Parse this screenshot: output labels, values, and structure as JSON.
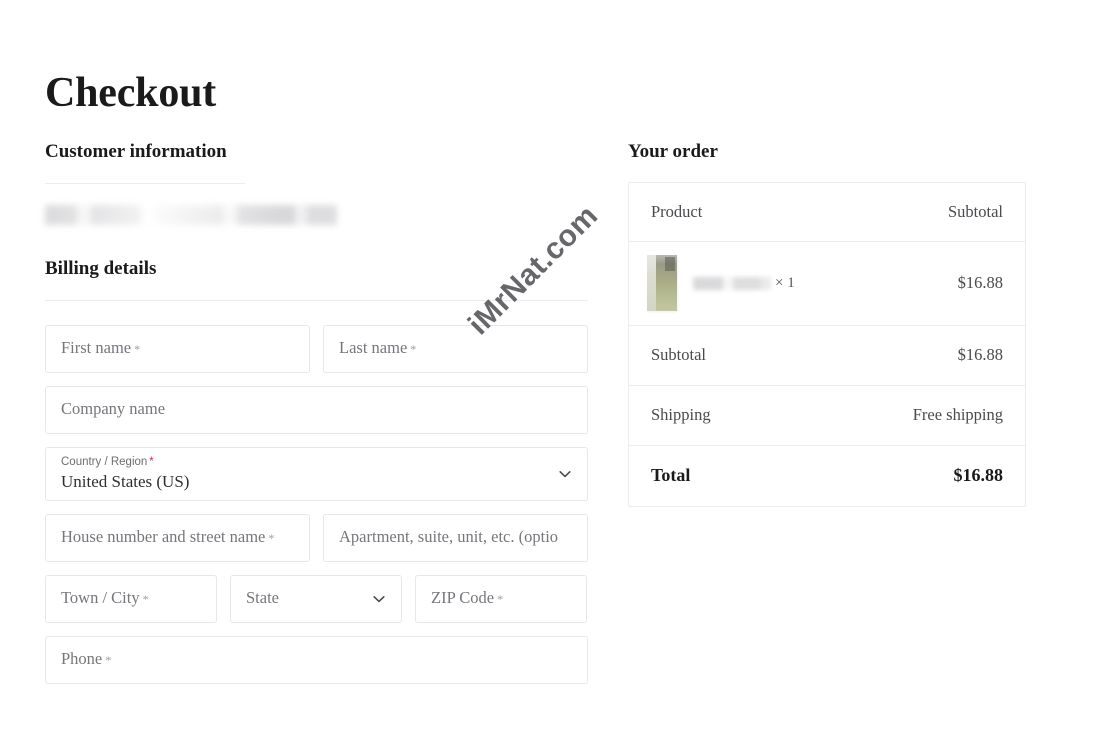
{
  "page": {
    "title": "Checkout"
  },
  "customer_section": {
    "heading": "Customer information",
    "redacted_note": ""
  },
  "billing_section": {
    "heading": "Billing details",
    "fields": {
      "first_name": {
        "placeholder": "First name",
        "required_mark": "*",
        "value": ""
      },
      "last_name": {
        "placeholder": "Last name",
        "required_mark": "*",
        "value": ""
      },
      "company_name": {
        "placeholder": "Company name",
        "required_mark": "",
        "value": ""
      },
      "country": {
        "label": "Country / Region",
        "required_mark": "*",
        "value": "United States (US)",
        "icon": "chevron-down-icon"
      },
      "street_address": {
        "placeholder": "House number and street name",
        "required_mark": "*",
        "value": ""
      },
      "address_2": {
        "placeholder": "Apartment, suite, unit, etc. (optio",
        "required_mark": "",
        "value": ""
      },
      "city": {
        "placeholder": "Town / City",
        "required_mark": "*",
        "value": ""
      },
      "state": {
        "placeholder": "State",
        "required_mark": "",
        "value": "",
        "icon": "chevron-down-icon"
      },
      "zip": {
        "placeholder": "ZIP Code",
        "required_mark": "*",
        "value": ""
      },
      "phone": {
        "placeholder": "Phone",
        "required_mark": "*",
        "value": ""
      }
    }
  },
  "order_section": {
    "heading": "Your order",
    "columns": {
      "product": "Product",
      "subtotal": "Subtotal"
    },
    "items": [
      {
        "name_redacted": "",
        "quantity_label": "× 1",
        "subtotal": "$16.88",
        "thumbnail": "product-thumbnail"
      }
    ],
    "summary": [
      {
        "label": "Subtotal",
        "value": "$16.88"
      },
      {
        "label": "Shipping",
        "value": "Free shipping"
      }
    ],
    "total": {
      "label": "Total",
      "value": "$16.88"
    }
  },
  "watermark": {
    "text": "iMrNat.com"
  },
  "colors": {
    "text_primary": "#1a1a1a",
    "text_secondary": "#4a4a4f",
    "placeholder": "#76767c",
    "border": "#e7e7e9",
    "table_border": "#ececee",
    "required_asterisk": "#cc2f4a",
    "background": "#ffffff"
  }
}
